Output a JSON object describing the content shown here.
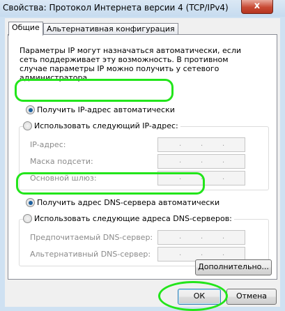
{
  "window": {
    "title": "Свойства: Протокол Интернета версии 4 (TCP/IPv4)",
    "close_glyph": "x"
  },
  "tabs": [
    {
      "label": "Общие",
      "active": true
    },
    {
      "label": "Альтернативная конфигурация",
      "active": false
    }
  ],
  "description": "Параметры IP могут назначаться автоматически, если сеть поддерживает эту возможность. В противном случае параметры IP можно получить у сетевого администратора.",
  "ip_section": {
    "auto_label": "Получить IP-адрес автоматически",
    "manual_label": "Использовать следующий IP-адрес:",
    "fields": [
      {
        "label": "IP-адрес:"
      },
      {
        "label": "Маска подсети:"
      },
      {
        "label": "Основной шлюз:"
      }
    ]
  },
  "dns_section": {
    "auto_label": "Получить адрес DNS-сервера автоматически",
    "manual_label": "Использовать следующие адреса DNS-серверов:",
    "fields": [
      {
        "label": "Предпочитаемый DNS-сервер:"
      },
      {
        "label": "Альтернативный DNS-сервер:"
      }
    ]
  },
  "ip_separator": ".",
  "buttons": {
    "advanced": "Дополнительно...",
    "ok": "ОК",
    "cancel": "Отмена"
  },
  "colors": {
    "highlight": "#22e51a",
    "selected_radio": "#1d5f9e",
    "title_bar": "#cfe1f2"
  }
}
